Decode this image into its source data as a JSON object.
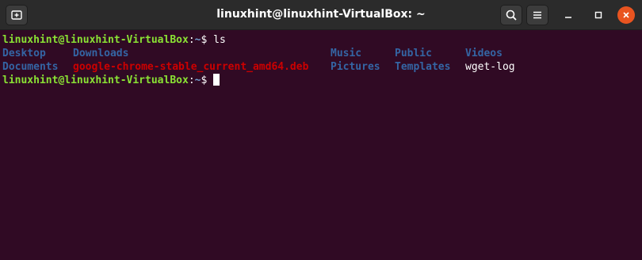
{
  "window": {
    "title": "linuxhint@linuxhint-VirtualBox: ~"
  },
  "icons": {
    "new_tab": "new-tab-icon",
    "search": "search-icon",
    "menu": "hamburger-menu-icon",
    "minimize": "minimize-icon",
    "maximize": "maximize-icon",
    "close": "close-icon"
  },
  "colors": {
    "terminal_bg": "#300a24",
    "prompt_user": "#8ae234",
    "prompt_path": "#729fcf",
    "directory": "#3465a4",
    "archive": "#cc0000",
    "close_button": "#e95420"
  },
  "terminal": {
    "line1": {
      "user_host": "linuxhint@linuxhint-VirtualBox",
      "sep": ":",
      "path": "~",
      "symbol": "$ ",
      "command": "ls"
    },
    "ls_row1": [
      "Desktop",
      "Downloads",
      "Music",
      "Public",
      "Videos"
    ],
    "ls_row2": [
      "Documents",
      "google-chrome-stable_current_amd64.deb",
      "Pictures",
      "Templates",
      "wget-log"
    ],
    "line3": {
      "user_host": "linuxhint@linuxhint-VirtualBox",
      "sep": ":",
      "path": "~",
      "symbol": "$ "
    }
  }
}
